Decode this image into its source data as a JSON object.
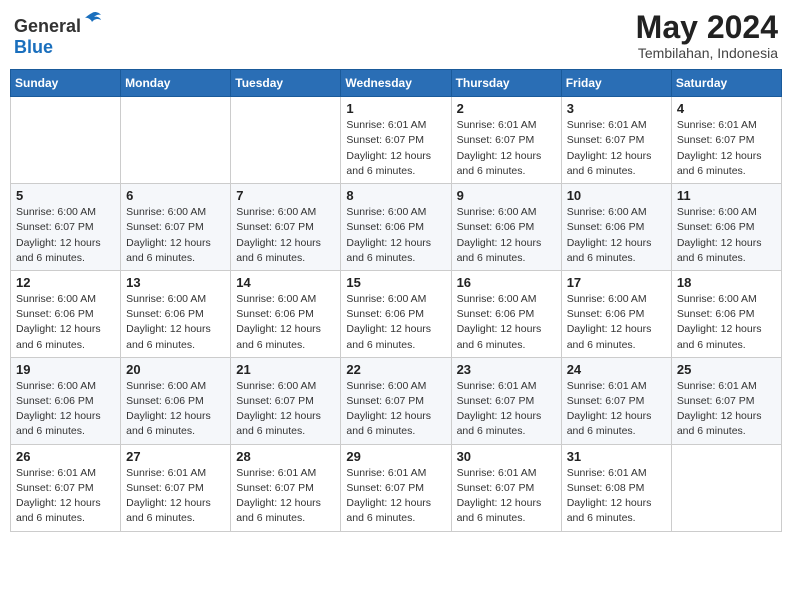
{
  "header": {
    "logo_general": "General",
    "logo_blue": "Blue",
    "month_year": "May 2024",
    "location": "Tembilahan, Indonesia"
  },
  "days_of_week": [
    "Sunday",
    "Monday",
    "Tuesday",
    "Wednesday",
    "Thursday",
    "Friday",
    "Saturday"
  ],
  "weeks": [
    {
      "days": [
        {
          "number": "",
          "detail": ""
        },
        {
          "number": "",
          "detail": ""
        },
        {
          "number": "",
          "detail": ""
        },
        {
          "number": "1",
          "detail": "Sunrise: 6:01 AM\nSunset: 6:07 PM\nDaylight: 12 hours\nand 6 minutes."
        },
        {
          "number": "2",
          "detail": "Sunrise: 6:01 AM\nSunset: 6:07 PM\nDaylight: 12 hours\nand 6 minutes."
        },
        {
          "number": "3",
          "detail": "Sunrise: 6:01 AM\nSunset: 6:07 PM\nDaylight: 12 hours\nand 6 minutes."
        },
        {
          "number": "4",
          "detail": "Sunrise: 6:01 AM\nSunset: 6:07 PM\nDaylight: 12 hours\nand 6 minutes."
        }
      ]
    },
    {
      "days": [
        {
          "number": "5",
          "detail": "Sunrise: 6:00 AM\nSunset: 6:07 PM\nDaylight: 12 hours\nand 6 minutes."
        },
        {
          "number": "6",
          "detail": "Sunrise: 6:00 AM\nSunset: 6:07 PM\nDaylight: 12 hours\nand 6 minutes."
        },
        {
          "number": "7",
          "detail": "Sunrise: 6:00 AM\nSunset: 6:07 PM\nDaylight: 12 hours\nand 6 minutes."
        },
        {
          "number": "8",
          "detail": "Sunrise: 6:00 AM\nSunset: 6:06 PM\nDaylight: 12 hours\nand 6 minutes."
        },
        {
          "number": "9",
          "detail": "Sunrise: 6:00 AM\nSunset: 6:06 PM\nDaylight: 12 hours\nand 6 minutes."
        },
        {
          "number": "10",
          "detail": "Sunrise: 6:00 AM\nSunset: 6:06 PM\nDaylight: 12 hours\nand 6 minutes."
        },
        {
          "number": "11",
          "detail": "Sunrise: 6:00 AM\nSunset: 6:06 PM\nDaylight: 12 hours\nand 6 minutes."
        }
      ]
    },
    {
      "days": [
        {
          "number": "12",
          "detail": "Sunrise: 6:00 AM\nSunset: 6:06 PM\nDaylight: 12 hours\nand 6 minutes."
        },
        {
          "number": "13",
          "detail": "Sunrise: 6:00 AM\nSunset: 6:06 PM\nDaylight: 12 hours\nand 6 minutes."
        },
        {
          "number": "14",
          "detail": "Sunrise: 6:00 AM\nSunset: 6:06 PM\nDaylight: 12 hours\nand 6 minutes."
        },
        {
          "number": "15",
          "detail": "Sunrise: 6:00 AM\nSunset: 6:06 PM\nDaylight: 12 hours\nand 6 minutes."
        },
        {
          "number": "16",
          "detail": "Sunrise: 6:00 AM\nSunset: 6:06 PM\nDaylight: 12 hours\nand 6 minutes."
        },
        {
          "number": "17",
          "detail": "Sunrise: 6:00 AM\nSunset: 6:06 PM\nDaylight: 12 hours\nand 6 minutes."
        },
        {
          "number": "18",
          "detail": "Sunrise: 6:00 AM\nSunset: 6:06 PM\nDaylight: 12 hours\nand 6 minutes."
        }
      ]
    },
    {
      "days": [
        {
          "number": "19",
          "detail": "Sunrise: 6:00 AM\nSunset: 6:06 PM\nDaylight: 12 hours\nand 6 minutes."
        },
        {
          "number": "20",
          "detail": "Sunrise: 6:00 AM\nSunset: 6:06 PM\nDaylight: 12 hours\nand 6 minutes."
        },
        {
          "number": "21",
          "detail": "Sunrise: 6:00 AM\nSunset: 6:07 PM\nDaylight: 12 hours\nand 6 minutes."
        },
        {
          "number": "22",
          "detail": "Sunrise: 6:00 AM\nSunset: 6:07 PM\nDaylight: 12 hours\nand 6 minutes."
        },
        {
          "number": "23",
          "detail": "Sunrise: 6:01 AM\nSunset: 6:07 PM\nDaylight: 12 hours\nand 6 minutes."
        },
        {
          "number": "24",
          "detail": "Sunrise: 6:01 AM\nSunset: 6:07 PM\nDaylight: 12 hours\nand 6 minutes."
        },
        {
          "number": "25",
          "detail": "Sunrise: 6:01 AM\nSunset: 6:07 PM\nDaylight: 12 hours\nand 6 minutes."
        }
      ]
    },
    {
      "days": [
        {
          "number": "26",
          "detail": "Sunrise: 6:01 AM\nSunset: 6:07 PM\nDaylight: 12 hours\nand 6 minutes."
        },
        {
          "number": "27",
          "detail": "Sunrise: 6:01 AM\nSunset: 6:07 PM\nDaylight: 12 hours\nand 6 minutes."
        },
        {
          "number": "28",
          "detail": "Sunrise: 6:01 AM\nSunset: 6:07 PM\nDaylight: 12 hours\nand 6 minutes."
        },
        {
          "number": "29",
          "detail": "Sunrise: 6:01 AM\nSunset: 6:07 PM\nDaylight: 12 hours\nand 6 minutes."
        },
        {
          "number": "30",
          "detail": "Sunrise: 6:01 AM\nSunset: 6:07 PM\nDaylight: 12 hours\nand 6 minutes."
        },
        {
          "number": "31",
          "detail": "Sunrise: 6:01 AM\nSunset: 6:08 PM\nDaylight: 12 hours\nand 6 minutes."
        },
        {
          "number": "",
          "detail": ""
        }
      ]
    }
  ]
}
